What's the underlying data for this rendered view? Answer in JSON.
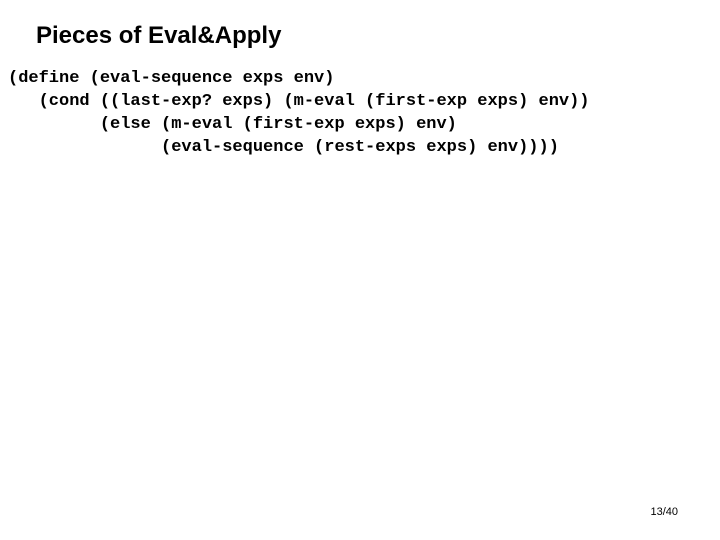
{
  "slide": {
    "title": "Pieces of Eval&Apply",
    "code_lines": {
      "l1": "(define (eval-sequence exps env)",
      "l2": "   (cond ((last-exp? exps) (m-eval (first-exp exps) env))",
      "l3": "         (else (m-eval (first-exp exps) env)",
      "l4": "               (eval-sequence (rest-exps exps) env))))"
    },
    "page_number": "13/40"
  }
}
